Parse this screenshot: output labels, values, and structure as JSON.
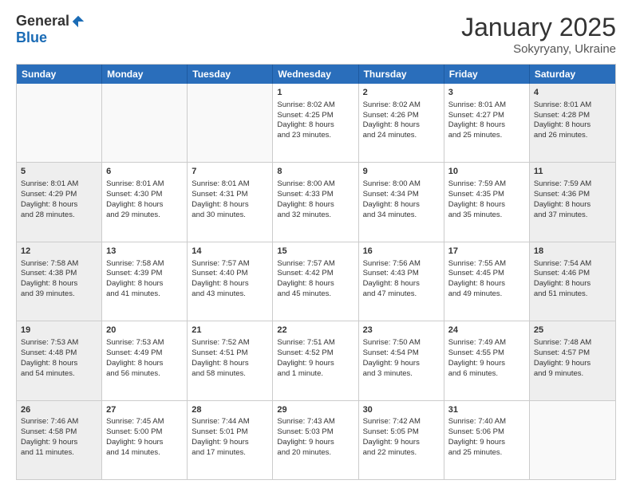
{
  "logo": {
    "general": "General",
    "blue": "Blue"
  },
  "title": "January 2025",
  "subtitle": "Sokyryany, Ukraine",
  "header_days": [
    "Sunday",
    "Monday",
    "Tuesday",
    "Wednesday",
    "Thursday",
    "Friday",
    "Saturday"
  ],
  "weeks": [
    [
      {
        "day": "",
        "lines": [],
        "empty": true
      },
      {
        "day": "",
        "lines": [],
        "empty": true
      },
      {
        "day": "",
        "lines": [],
        "empty": true
      },
      {
        "day": "1",
        "lines": [
          "Sunrise: 8:02 AM",
          "Sunset: 4:25 PM",
          "Daylight: 8 hours",
          "and 23 minutes."
        ]
      },
      {
        "day": "2",
        "lines": [
          "Sunrise: 8:02 AM",
          "Sunset: 4:26 PM",
          "Daylight: 8 hours",
          "and 24 minutes."
        ]
      },
      {
        "day": "3",
        "lines": [
          "Sunrise: 8:01 AM",
          "Sunset: 4:27 PM",
          "Daylight: 8 hours",
          "and 25 minutes."
        ]
      },
      {
        "day": "4",
        "lines": [
          "Sunrise: 8:01 AM",
          "Sunset: 4:28 PM",
          "Daylight: 8 hours",
          "and 26 minutes."
        ],
        "shaded": true
      }
    ],
    [
      {
        "day": "5",
        "lines": [
          "Sunrise: 8:01 AM",
          "Sunset: 4:29 PM",
          "Daylight: 8 hours",
          "and 28 minutes."
        ],
        "shaded": true
      },
      {
        "day": "6",
        "lines": [
          "Sunrise: 8:01 AM",
          "Sunset: 4:30 PM",
          "Daylight: 8 hours",
          "and 29 minutes."
        ]
      },
      {
        "day": "7",
        "lines": [
          "Sunrise: 8:01 AM",
          "Sunset: 4:31 PM",
          "Daylight: 8 hours",
          "and 30 minutes."
        ]
      },
      {
        "day": "8",
        "lines": [
          "Sunrise: 8:00 AM",
          "Sunset: 4:33 PM",
          "Daylight: 8 hours",
          "and 32 minutes."
        ]
      },
      {
        "day": "9",
        "lines": [
          "Sunrise: 8:00 AM",
          "Sunset: 4:34 PM",
          "Daylight: 8 hours",
          "and 34 minutes."
        ]
      },
      {
        "day": "10",
        "lines": [
          "Sunrise: 7:59 AM",
          "Sunset: 4:35 PM",
          "Daylight: 8 hours",
          "and 35 minutes."
        ]
      },
      {
        "day": "11",
        "lines": [
          "Sunrise: 7:59 AM",
          "Sunset: 4:36 PM",
          "Daylight: 8 hours",
          "and 37 minutes."
        ],
        "shaded": true
      }
    ],
    [
      {
        "day": "12",
        "lines": [
          "Sunrise: 7:58 AM",
          "Sunset: 4:38 PM",
          "Daylight: 8 hours",
          "and 39 minutes."
        ],
        "shaded": true
      },
      {
        "day": "13",
        "lines": [
          "Sunrise: 7:58 AM",
          "Sunset: 4:39 PM",
          "Daylight: 8 hours",
          "and 41 minutes."
        ]
      },
      {
        "day": "14",
        "lines": [
          "Sunrise: 7:57 AM",
          "Sunset: 4:40 PM",
          "Daylight: 8 hours",
          "and 43 minutes."
        ]
      },
      {
        "day": "15",
        "lines": [
          "Sunrise: 7:57 AM",
          "Sunset: 4:42 PM",
          "Daylight: 8 hours",
          "and 45 minutes."
        ]
      },
      {
        "day": "16",
        "lines": [
          "Sunrise: 7:56 AM",
          "Sunset: 4:43 PM",
          "Daylight: 8 hours",
          "and 47 minutes."
        ]
      },
      {
        "day": "17",
        "lines": [
          "Sunrise: 7:55 AM",
          "Sunset: 4:45 PM",
          "Daylight: 8 hours",
          "and 49 minutes."
        ]
      },
      {
        "day": "18",
        "lines": [
          "Sunrise: 7:54 AM",
          "Sunset: 4:46 PM",
          "Daylight: 8 hours",
          "and 51 minutes."
        ],
        "shaded": true
      }
    ],
    [
      {
        "day": "19",
        "lines": [
          "Sunrise: 7:53 AM",
          "Sunset: 4:48 PM",
          "Daylight: 8 hours",
          "and 54 minutes."
        ],
        "shaded": true
      },
      {
        "day": "20",
        "lines": [
          "Sunrise: 7:53 AM",
          "Sunset: 4:49 PM",
          "Daylight: 8 hours",
          "and 56 minutes."
        ]
      },
      {
        "day": "21",
        "lines": [
          "Sunrise: 7:52 AM",
          "Sunset: 4:51 PM",
          "Daylight: 8 hours",
          "and 58 minutes."
        ]
      },
      {
        "day": "22",
        "lines": [
          "Sunrise: 7:51 AM",
          "Sunset: 4:52 PM",
          "Daylight: 9 hours",
          "and 1 minute."
        ]
      },
      {
        "day": "23",
        "lines": [
          "Sunrise: 7:50 AM",
          "Sunset: 4:54 PM",
          "Daylight: 9 hours",
          "and 3 minutes."
        ]
      },
      {
        "day": "24",
        "lines": [
          "Sunrise: 7:49 AM",
          "Sunset: 4:55 PM",
          "Daylight: 9 hours",
          "and 6 minutes."
        ]
      },
      {
        "day": "25",
        "lines": [
          "Sunrise: 7:48 AM",
          "Sunset: 4:57 PM",
          "Daylight: 9 hours",
          "and 9 minutes."
        ],
        "shaded": true
      }
    ],
    [
      {
        "day": "26",
        "lines": [
          "Sunrise: 7:46 AM",
          "Sunset: 4:58 PM",
          "Daylight: 9 hours",
          "and 11 minutes."
        ],
        "shaded": true
      },
      {
        "day": "27",
        "lines": [
          "Sunrise: 7:45 AM",
          "Sunset: 5:00 PM",
          "Daylight: 9 hours",
          "and 14 minutes."
        ]
      },
      {
        "day": "28",
        "lines": [
          "Sunrise: 7:44 AM",
          "Sunset: 5:01 PM",
          "Daylight: 9 hours",
          "and 17 minutes."
        ]
      },
      {
        "day": "29",
        "lines": [
          "Sunrise: 7:43 AM",
          "Sunset: 5:03 PM",
          "Daylight: 9 hours",
          "and 20 minutes."
        ]
      },
      {
        "day": "30",
        "lines": [
          "Sunrise: 7:42 AM",
          "Sunset: 5:05 PM",
          "Daylight: 9 hours",
          "and 22 minutes."
        ]
      },
      {
        "day": "31",
        "lines": [
          "Sunrise: 7:40 AM",
          "Sunset: 5:06 PM",
          "Daylight: 9 hours",
          "and 25 minutes."
        ]
      },
      {
        "day": "",
        "lines": [],
        "empty": true
      }
    ]
  ]
}
